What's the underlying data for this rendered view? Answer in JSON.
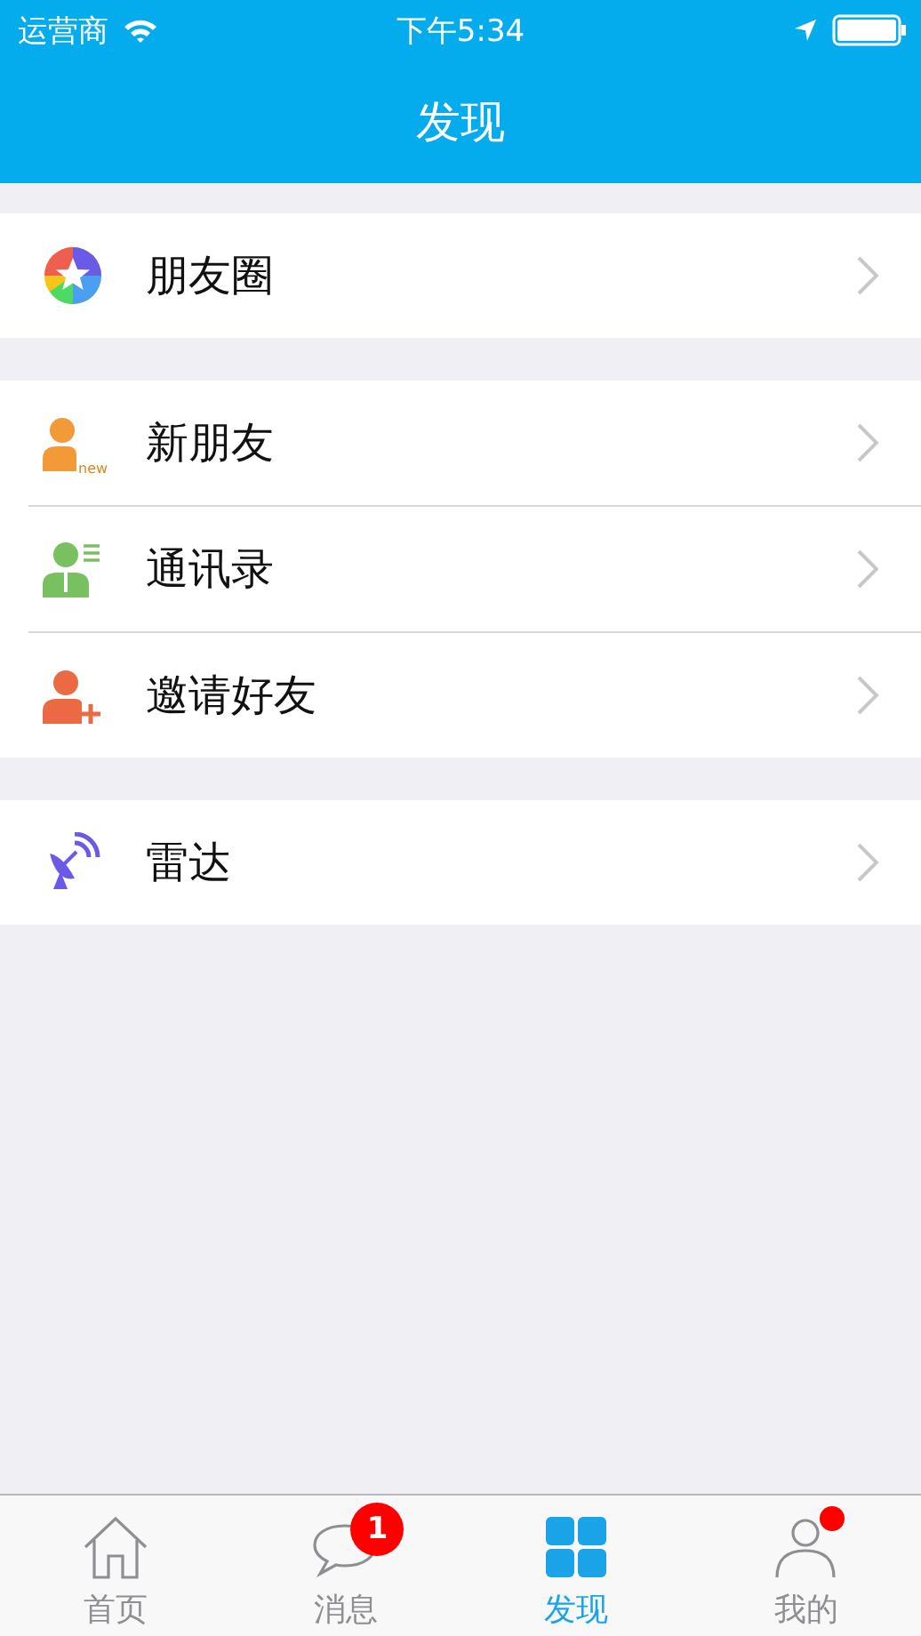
{
  "status_bar": {
    "carrier": "运营商",
    "time": "下午5:34"
  },
  "nav_bar": {
    "title": "发现"
  },
  "groups": [
    {
      "items": [
        {
          "label": "朋友圈",
          "kind": "moments"
        }
      ]
    },
    {
      "items": [
        {
          "label": "新朋友",
          "kind": "new-friend",
          "icon_text": "new"
        },
        {
          "label": "通讯录",
          "kind": "contacts"
        },
        {
          "label": "邀请好友",
          "kind": "invite"
        }
      ]
    },
    {
      "items": [
        {
          "label": "雷达",
          "kind": "radar"
        }
      ]
    }
  ],
  "tab_bar": [
    {
      "label": "首页",
      "kind": "home",
      "selected": false
    },
    {
      "label": "消息",
      "kind": "chat",
      "selected": false,
      "badge": "1"
    },
    {
      "label": "发现",
      "kind": "grid",
      "selected": true
    },
    {
      "label": "我的",
      "kind": "person",
      "selected": false,
      "dot": true
    }
  ]
}
